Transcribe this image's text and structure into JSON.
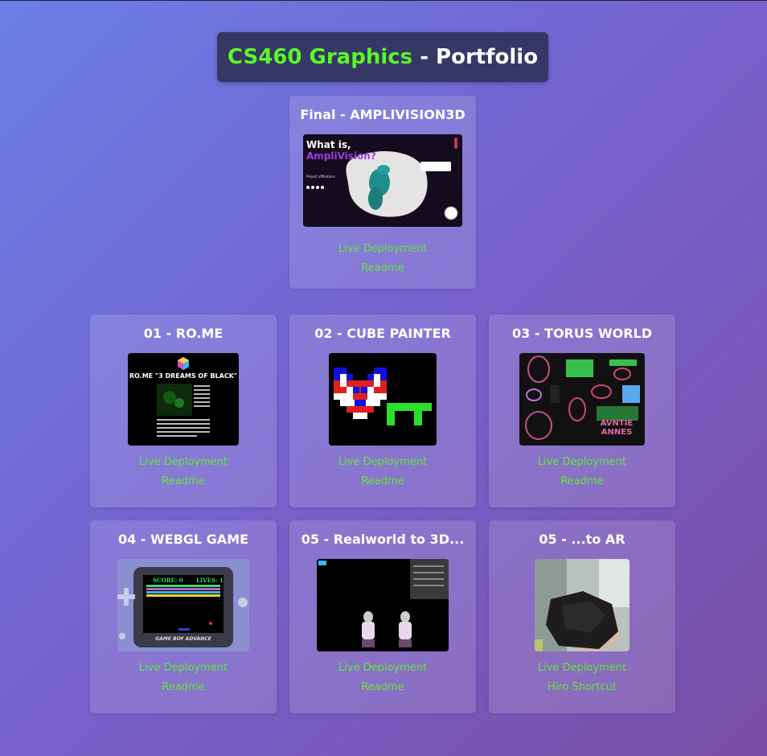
{
  "header": {
    "title_part1": "CS460 Graphics",
    "title_part2": " - Portfolio"
  },
  "final": {
    "title": "Final - AMPLIVISION3D",
    "thumb_heading1": "What is,",
    "thumb_heading2": "AmpliVision?",
    "thumb_small": "Project affiliations",
    "links": [
      "Live Deployment",
      "Readme"
    ]
  },
  "projects": [
    {
      "title": "01 - RO.ME",
      "thumb_caption": "RO.ME \"3 DREAMS OF BLACK\"",
      "links": [
        "Live Deployment",
        "Readme"
      ]
    },
    {
      "title": "02 - CUBE PAINTER",
      "links": [
        "Live Deployment",
        "Readme"
      ]
    },
    {
      "title": "03 - TORUS WORLD",
      "thumb_caption": "AVNTIE ANNES",
      "links": [
        "Live Deployment",
        "Readme"
      ]
    },
    {
      "title": "04 - WEBGL GAME",
      "thumb_score": "SCORE: 0",
      "thumb_lives": "LIVES: 1",
      "thumb_brand": "GAME BOY ADVANCE",
      "links": [
        "Live Deployment",
        "Readme"
      ]
    },
    {
      "title": "05 - Realworld to 3D...",
      "links": [
        "Live Deployment",
        "Readme"
      ]
    },
    {
      "title": "05 - ...to AR",
      "links": [
        "Live Deployment",
        "Hiro Shortcut"
      ]
    }
  ],
  "colors": {
    "accent_green": "#5df52a",
    "link_green": "#61e63b",
    "title_bg": "#353765"
  }
}
